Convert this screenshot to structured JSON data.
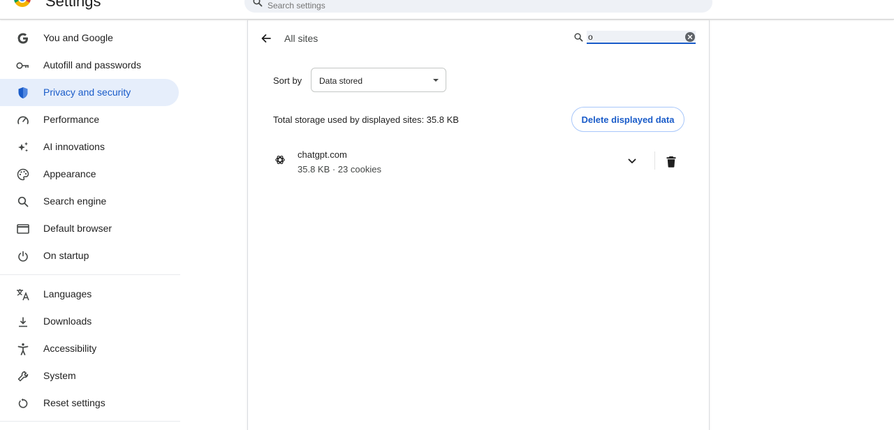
{
  "header": {
    "title": "Settings",
    "search_placeholder": "Search settings"
  },
  "sidebar": {
    "items": [
      {
        "label": "You and Google",
        "icon": "google-g-icon"
      },
      {
        "label": "Autofill and passwords",
        "icon": "key-icon"
      },
      {
        "label": "Privacy and security",
        "icon": "shield-icon",
        "active": true
      },
      {
        "label": "Performance",
        "icon": "speedometer-icon"
      },
      {
        "label": "AI innovations",
        "icon": "sparkle-icon"
      },
      {
        "label": "Appearance",
        "icon": "palette-icon"
      },
      {
        "label": "Search engine",
        "icon": "search-icon"
      },
      {
        "label": "Default browser",
        "icon": "browser-window-icon"
      },
      {
        "label": "On startup",
        "icon": "power-icon"
      },
      {
        "label": "Languages",
        "icon": "translate-icon"
      },
      {
        "label": "Downloads",
        "icon": "download-icon"
      },
      {
        "label": "Accessibility",
        "icon": "accessibility-icon"
      },
      {
        "label": "System",
        "icon": "wrench-icon"
      },
      {
        "label": "Reset settings",
        "icon": "reset-icon"
      }
    ]
  },
  "main": {
    "title": "All sites",
    "site_search_value": "o",
    "sort_label": "Sort by",
    "sort_value": "Data stored",
    "storage_summary": "Total storage used by displayed sites: 35.8 KB",
    "delete_button": "Delete displayed data",
    "sites": [
      {
        "name": "chatgpt.com",
        "detail": "35.8 KB · 23 cookies",
        "icon": "openai-icon"
      }
    ]
  },
  "colors": {
    "accent": "#1a5cc9",
    "active_bg": "#e6eefb",
    "search_bg": "#eef1f6"
  }
}
